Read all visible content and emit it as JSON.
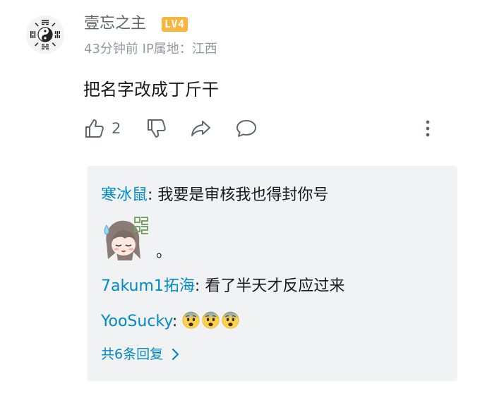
{
  "comment": {
    "username": "壹忘之主",
    "level": "LV4",
    "time": "43分钟前",
    "ip_location": "IP属地：江西",
    "text": "把名字改成丁斤干",
    "like_count": "2"
  },
  "replies": {
    "items": [
      {
        "user": "寒冰鼠",
        "sep": ": ",
        "text": "我要是审核我也得封你号"
      },
      {
        "sticker_suffix": "。"
      },
      {
        "user": "7akum1拓海",
        "sep": ": ",
        "text": "看了半天才反应过来"
      },
      {
        "user": "YooSucky",
        "sep": ": ",
        "emoji_count": 3
      }
    ],
    "view_more": "共6条回复"
  },
  "colors": {
    "link_blue": "#008ac5",
    "level_badge": "#fbb43d",
    "reply_bg": "#f1f2f3",
    "meta_gray": "#9499a0"
  },
  "icons": [
    "avatar-bagua",
    "thumb-up-icon",
    "thumb-down-icon",
    "share-icon",
    "reply-icon",
    "more-vertical-icon",
    "chevron-right-icon",
    "fearful-face-emoji"
  ]
}
